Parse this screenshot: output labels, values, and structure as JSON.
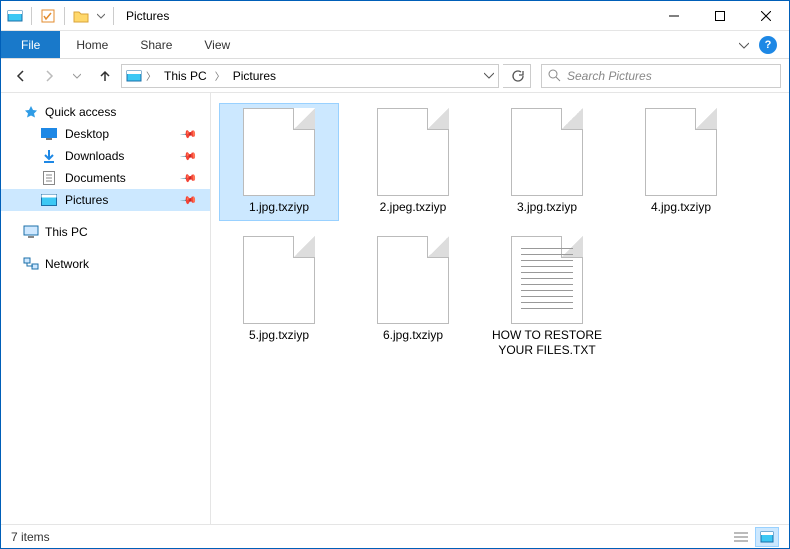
{
  "title": "Pictures",
  "ribbon": {
    "file": "File",
    "tabs": [
      "Home",
      "Share",
      "View"
    ]
  },
  "breadcrumbs": [
    "This PC",
    "Pictures"
  ],
  "search": {
    "placeholder": "Search Pictures"
  },
  "sidebar": {
    "quick_access": {
      "label": "Quick access",
      "items": [
        {
          "label": "Desktop",
          "pinned": true
        },
        {
          "label": "Downloads",
          "pinned": true
        },
        {
          "label": "Documents",
          "pinned": true
        },
        {
          "label": "Pictures",
          "pinned": true,
          "selected": true
        }
      ]
    },
    "this_pc": {
      "label": "This PC"
    },
    "network": {
      "label": "Network"
    }
  },
  "files": [
    {
      "name": "1.jpg.txziyp",
      "type": "blank",
      "selected": true
    },
    {
      "name": "2.jpeg.txziyp",
      "type": "blank"
    },
    {
      "name": "3.jpg.txziyp",
      "type": "blank"
    },
    {
      "name": "4.jpg.txziyp",
      "type": "blank"
    },
    {
      "name": "5.jpg.txziyp",
      "type": "blank"
    },
    {
      "name": "6.jpg.txziyp",
      "type": "blank"
    },
    {
      "name": "HOW TO RESTORE YOUR FILES.TXT",
      "type": "text"
    }
  ],
  "status": {
    "count": "7 items"
  }
}
